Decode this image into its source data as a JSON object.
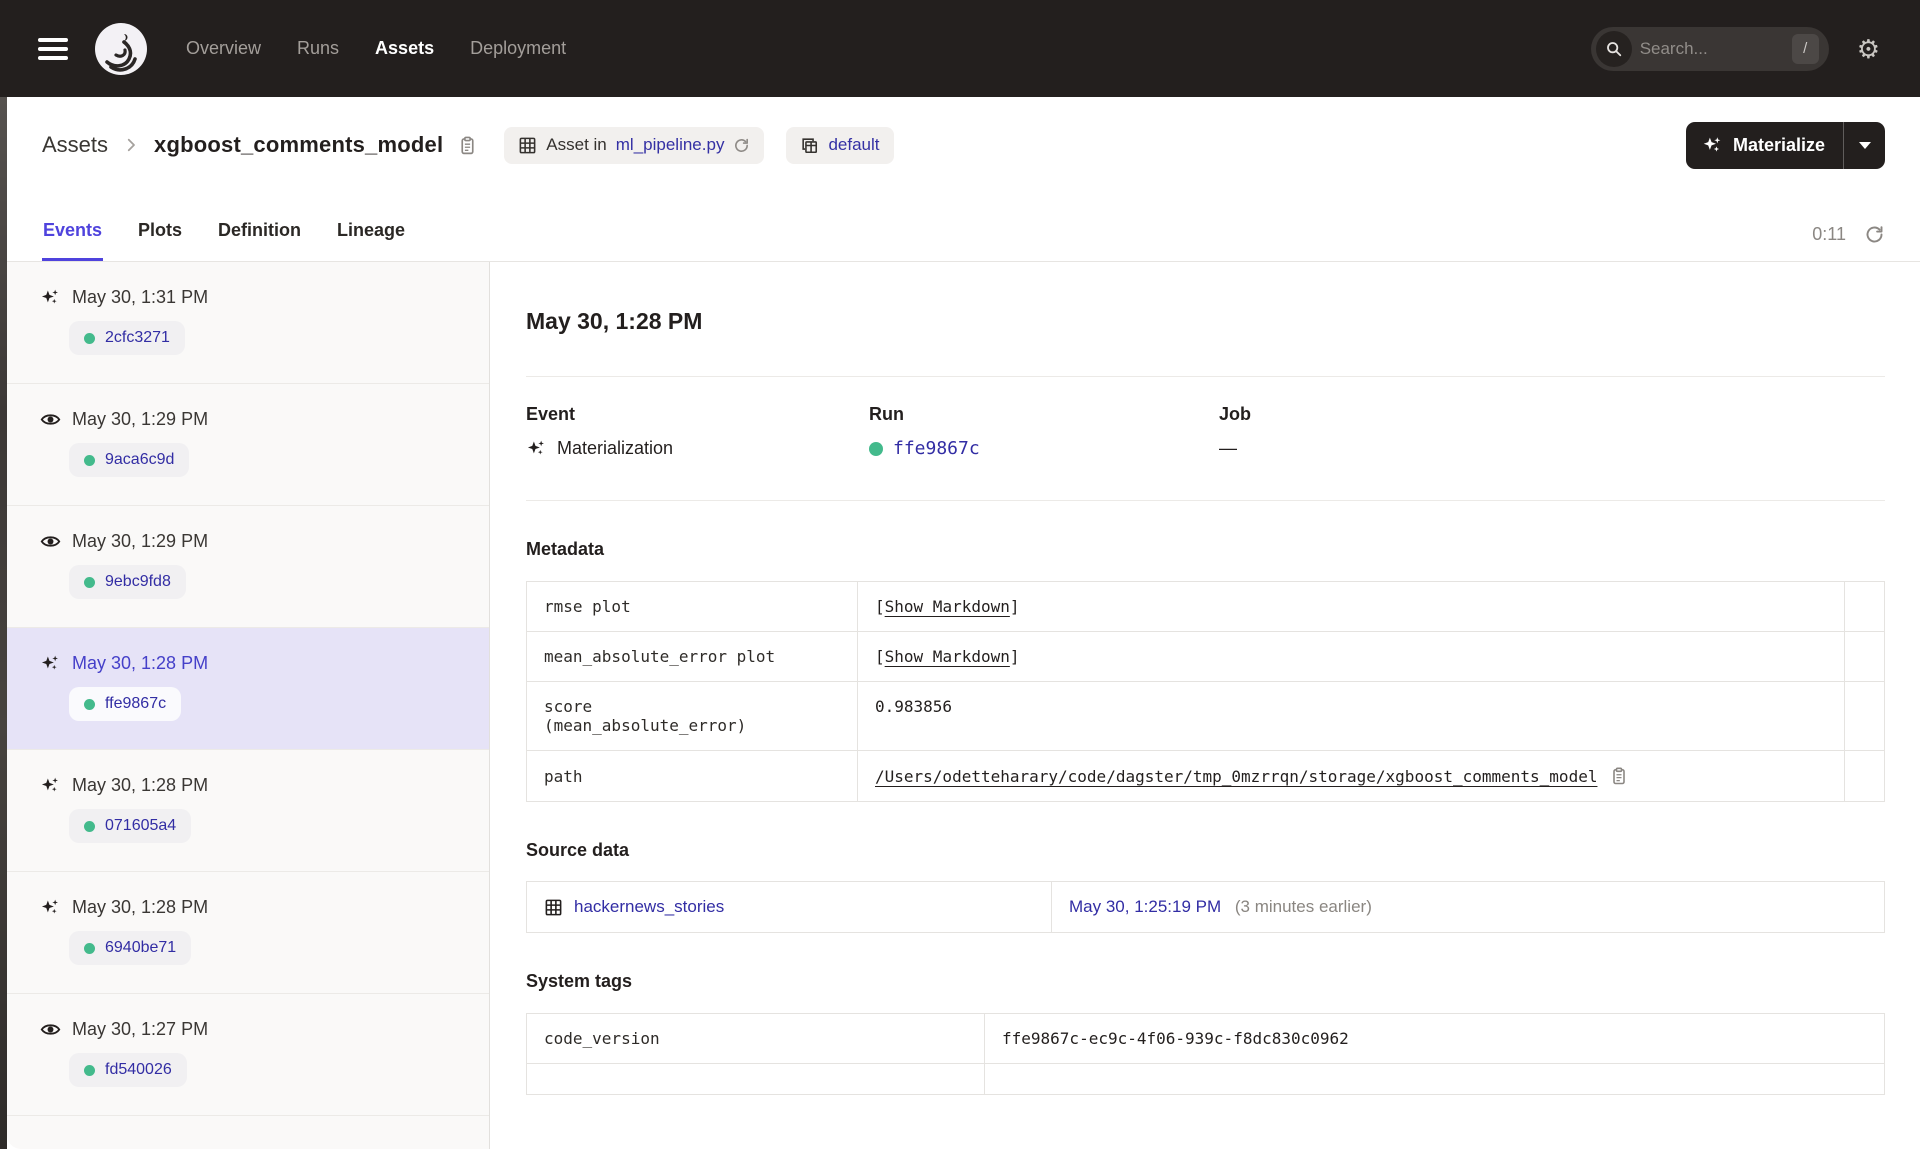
{
  "colors": {
    "topnav_bg": "#231F1E",
    "accent": "#4F43DD",
    "link": "#3430A4",
    "success_green": "#43BA8C",
    "selected_row_bg": "#E6E3F7"
  },
  "topnav": {
    "items": [
      {
        "label": "Overview"
      },
      {
        "label": "Runs"
      },
      {
        "label": "Assets"
      },
      {
        "label": "Deployment"
      }
    ],
    "search": {
      "placeholder": "Search...",
      "shortcut": "/"
    }
  },
  "breadcrumb": {
    "root": "Assets",
    "title": "xgboost_comments_model"
  },
  "badges": {
    "asset_in": {
      "prefix": "Asset in",
      "link": "ml_pipeline.py"
    },
    "group": {
      "label": "default"
    }
  },
  "materialize": {
    "label": "Materialize"
  },
  "tabs": [
    {
      "label": "Events"
    },
    {
      "label": "Plots"
    },
    {
      "label": "Definition"
    },
    {
      "label": "Lineage"
    }
  ],
  "refresh_timer": "0:11",
  "sidebar": {
    "events": [
      {
        "icon": "materialization",
        "time": "May 30, 1:31 PM",
        "run_id": "2cfc3271"
      },
      {
        "icon": "observation",
        "time": "May 30, 1:29 PM",
        "run_id": "9aca6c9d"
      },
      {
        "icon": "observation",
        "time": "May 30, 1:29 PM",
        "run_id": "9ebc9fd8"
      },
      {
        "icon": "materialization",
        "time": "May 30, 1:28 PM",
        "run_id": "ffe9867c",
        "selected": true
      },
      {
        "icon": "materialization",
        "time": "May 30, 1:28 PM",
        "run_id": "071605a4"
      },
      {
        "icon": "materialization",
        "time": "May 30, 1:28 PM",
        "run_id": "6940be71"
      },
      {
        "icon": "observation",
        "time": "May 30, 1:27 PM",
        "run_id": "fd540026"
      }
    ]
  },
  "detail": {
    "heading": "May 30, 1:28 PM",
    "event": {
      "label": "Event",
      "value": "Materialization"
    },
    "run": {
      "label": "Run",
      "value": "ffe9867c"
    },
    "job": {
      "label": "Job",
      "value": "—"
    },
    "metadata": {
      "title": "Metadata",
      "bracket_open": "[",
      "bracket_close": "]",
      "rows": [
        {
          "key": "rmse plot",
          "type": "markdown",
          "label": "Show Markdown"
        },
        {
          "key": "mean_absolute_error plot",
          "type": "markdown",
          "label": "Show Markdown"
        },
        {
          "key": "score\n(mean_absolute_error)",
          "type": "text",
          "value": "0.983856"
        },
        {
          "key": "path",
          "type": "link",
          "value": "/Users/odetteharary/code/dagster/tmp_0mzrrqn/storage/xgboost_comments_model"
        }
      ]
    },
    "source_data": {
      "title": "Source data",
      "asset": "hackernews_stories",
      "timestamp": "May 30, 1:25:19 PM",
      "relative": "(3 minutes earlier)"
    },
    "system_tags": {
      "title": "System tags",
      "rows": [
        {
          "key": "code_version",
          "value": "ffe9867c-ec9c-4f06-939c-f8dc830c0962"
        }
      ]
    }
  }
}
